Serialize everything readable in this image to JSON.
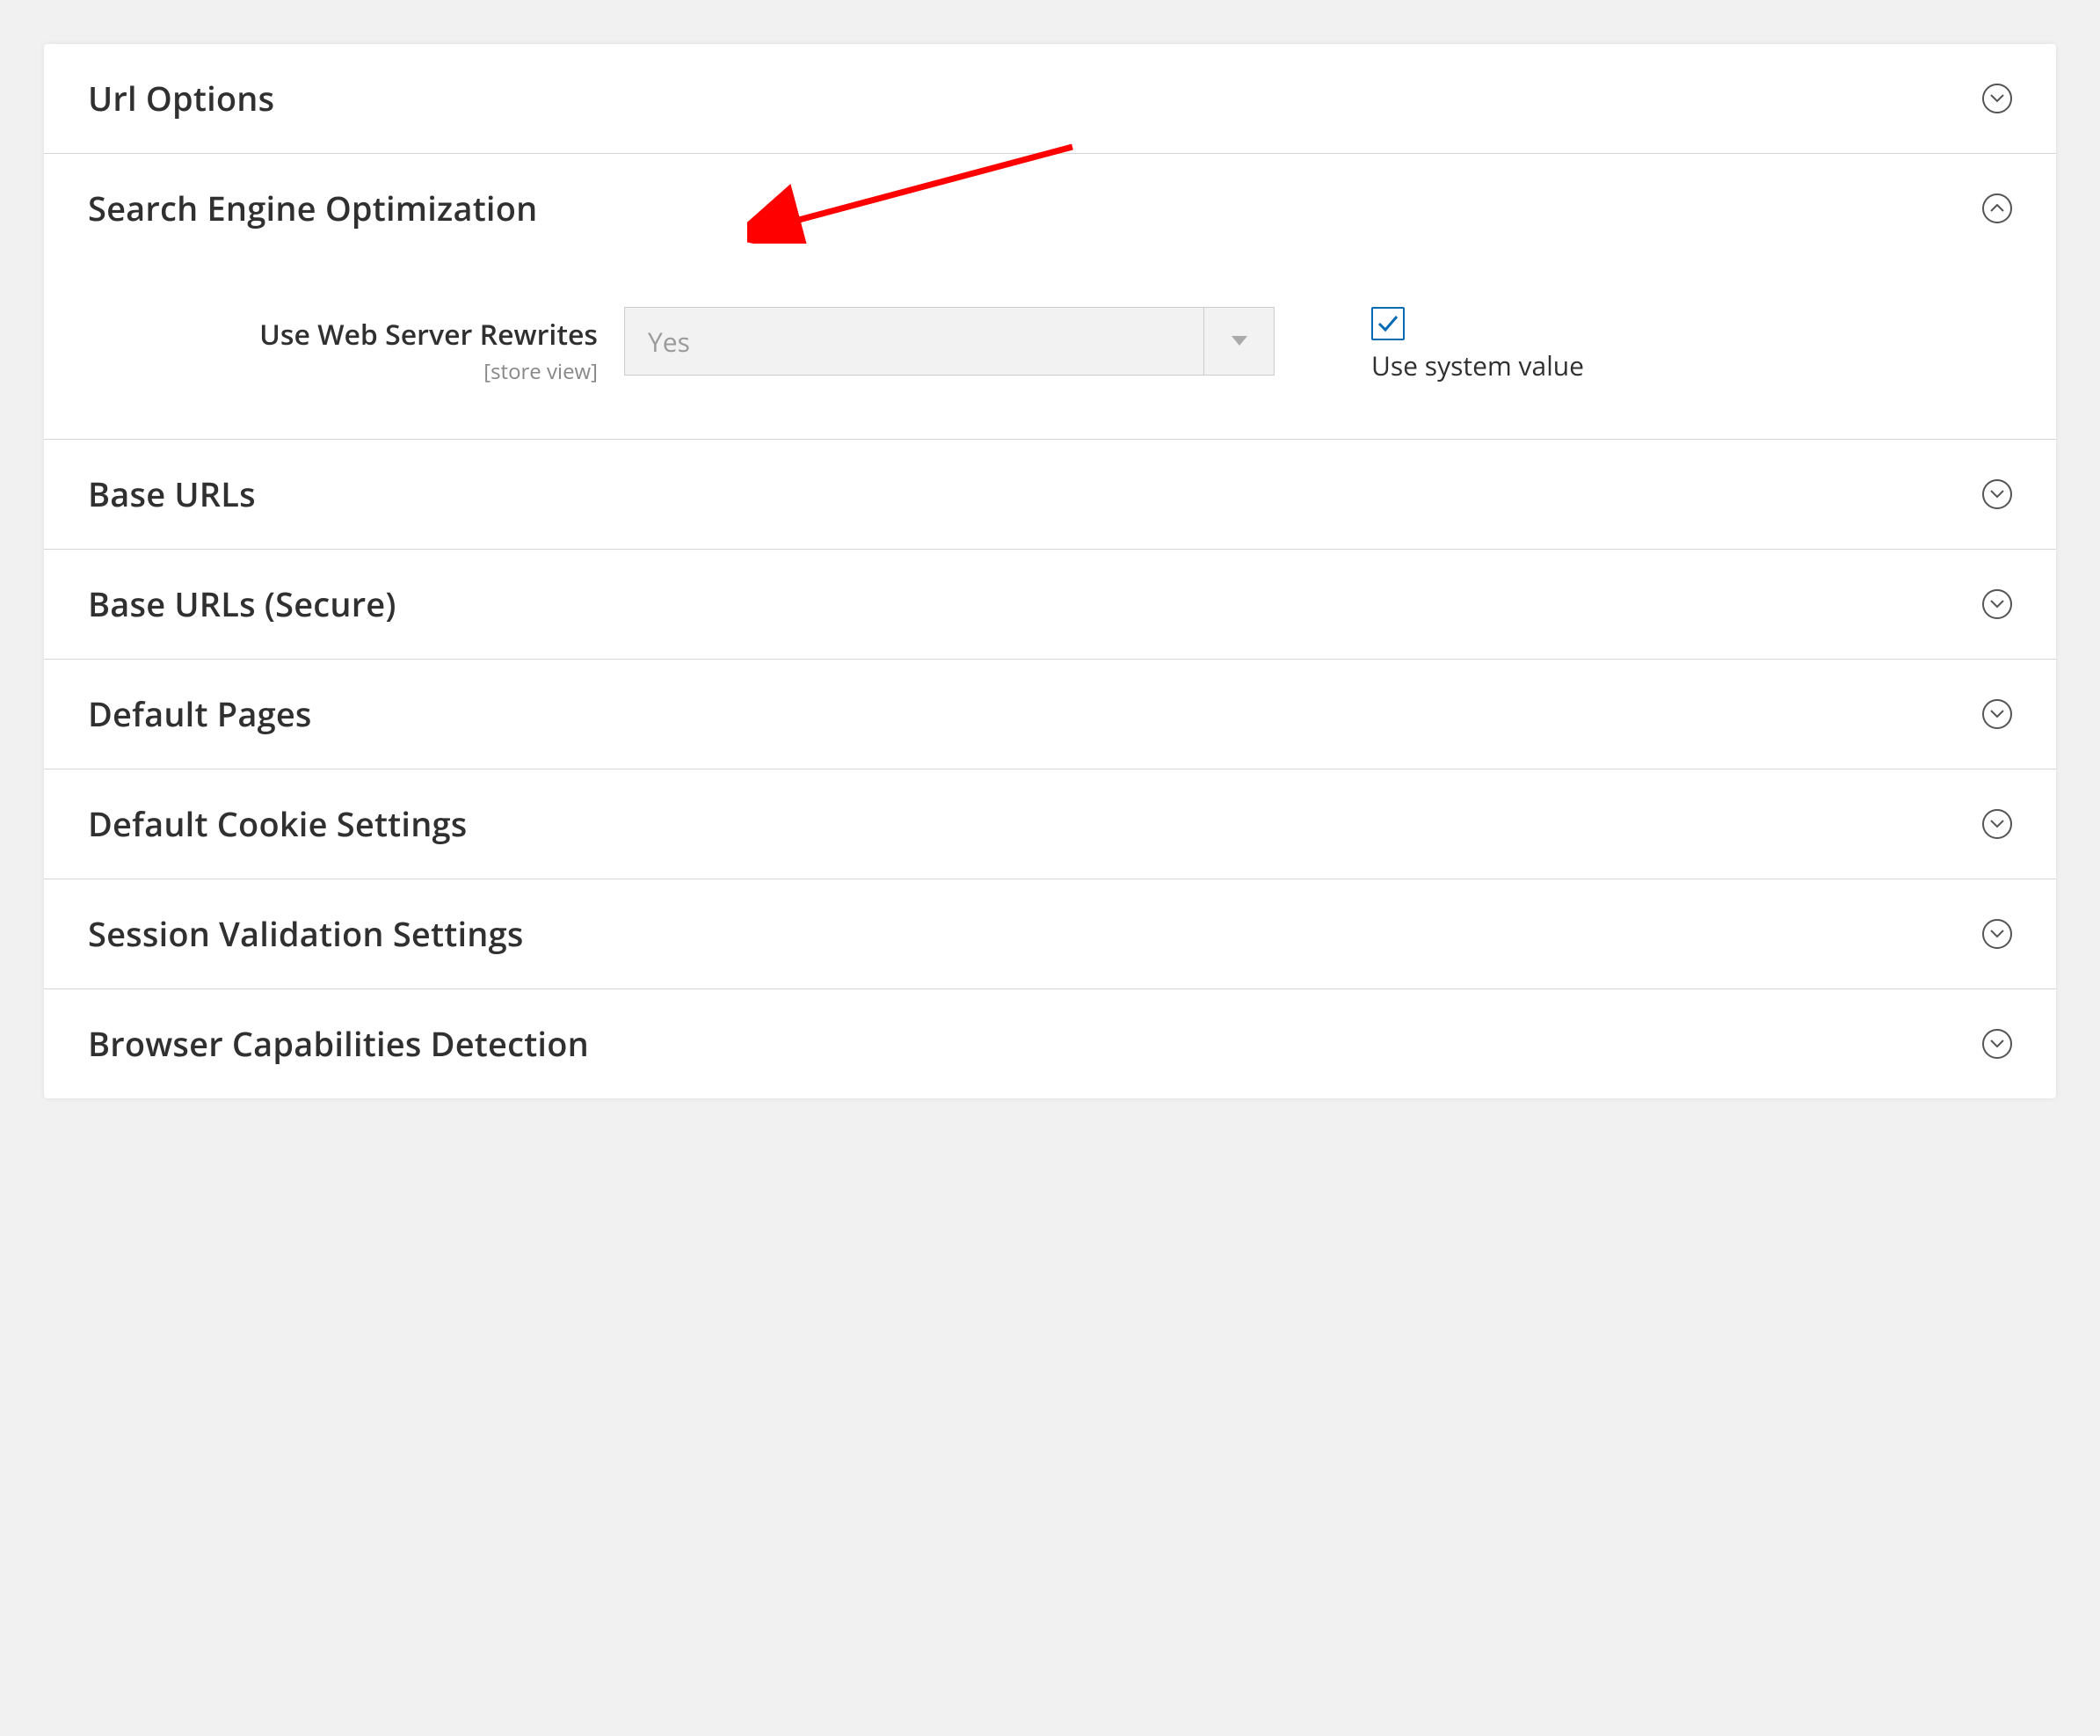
{
  "sections": {
    "url_options": {
      "title": "Url Options",
      "expanded": false
    },
    "seo": {
      "title": "Search Engine Optimization",
      "expanded": true,
      "field": {
        "label": "Use Web Server Rewrites",
        "scope": "[store view]",
        "value": "Yes",
        "use_system_label": "Use system value"
      }
    },
    "base_urls": {
      "title": "Base URLs",
      "expanded": false
    },
    "base_urls_secure": {
      "title": "Base URLs (Secure)",
      "expanded": false
    },
    "default_pages": {
      "title": "Default Pages",
      "expanded": false
    },
    "default_cookie": {
      "title": "Default Cookie Settings",
      "expanded": false
    },
    "session_validation": {
      "title": "Session Validation Settings",
      "expanded": false
    },
    "browser_caps": {
      "title": "Browser Capabilities Detection",
      "expanded": false
    }
  }
}
